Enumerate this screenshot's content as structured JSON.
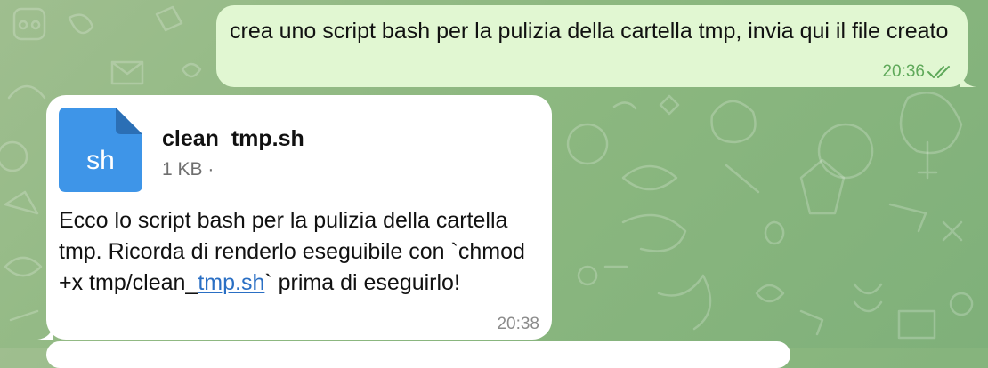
{
  "outgoing_message": {
    "text": "crea uno script bash per la pulizia della cartella tmp, invia qui il file creato",
    "time": "20:36",
    "status_icon": "double-check-icon"
  },
  "incoming_message": {
    "file": {
      "icon": "document-icon",
      "extension": "sh",
      "name": "clean_tmp.sh",
      "size": "1 KB ·"
    },
    "text_before_link": "Ecco lo script bash per la pulizia della cartella tmp. Ricorda di renderlo eseguibile con `chmod +x tmp/clean_",
    "link_text": "tmp.sh",
    "text_after_link": "` prima di eseguirlo!",
    "time": "20:38"
  },
  "colors": {
    "outgoing_bubble": "#e1f7d2",
    "incoming_bubble": "#ffffff",
    "file_icon": "#3e95e8",
    "file_icon_fold": "#2b6fb5",
    "link": "#2a6fc4",
    "check_marks": "#5fa95a"
  }
}
